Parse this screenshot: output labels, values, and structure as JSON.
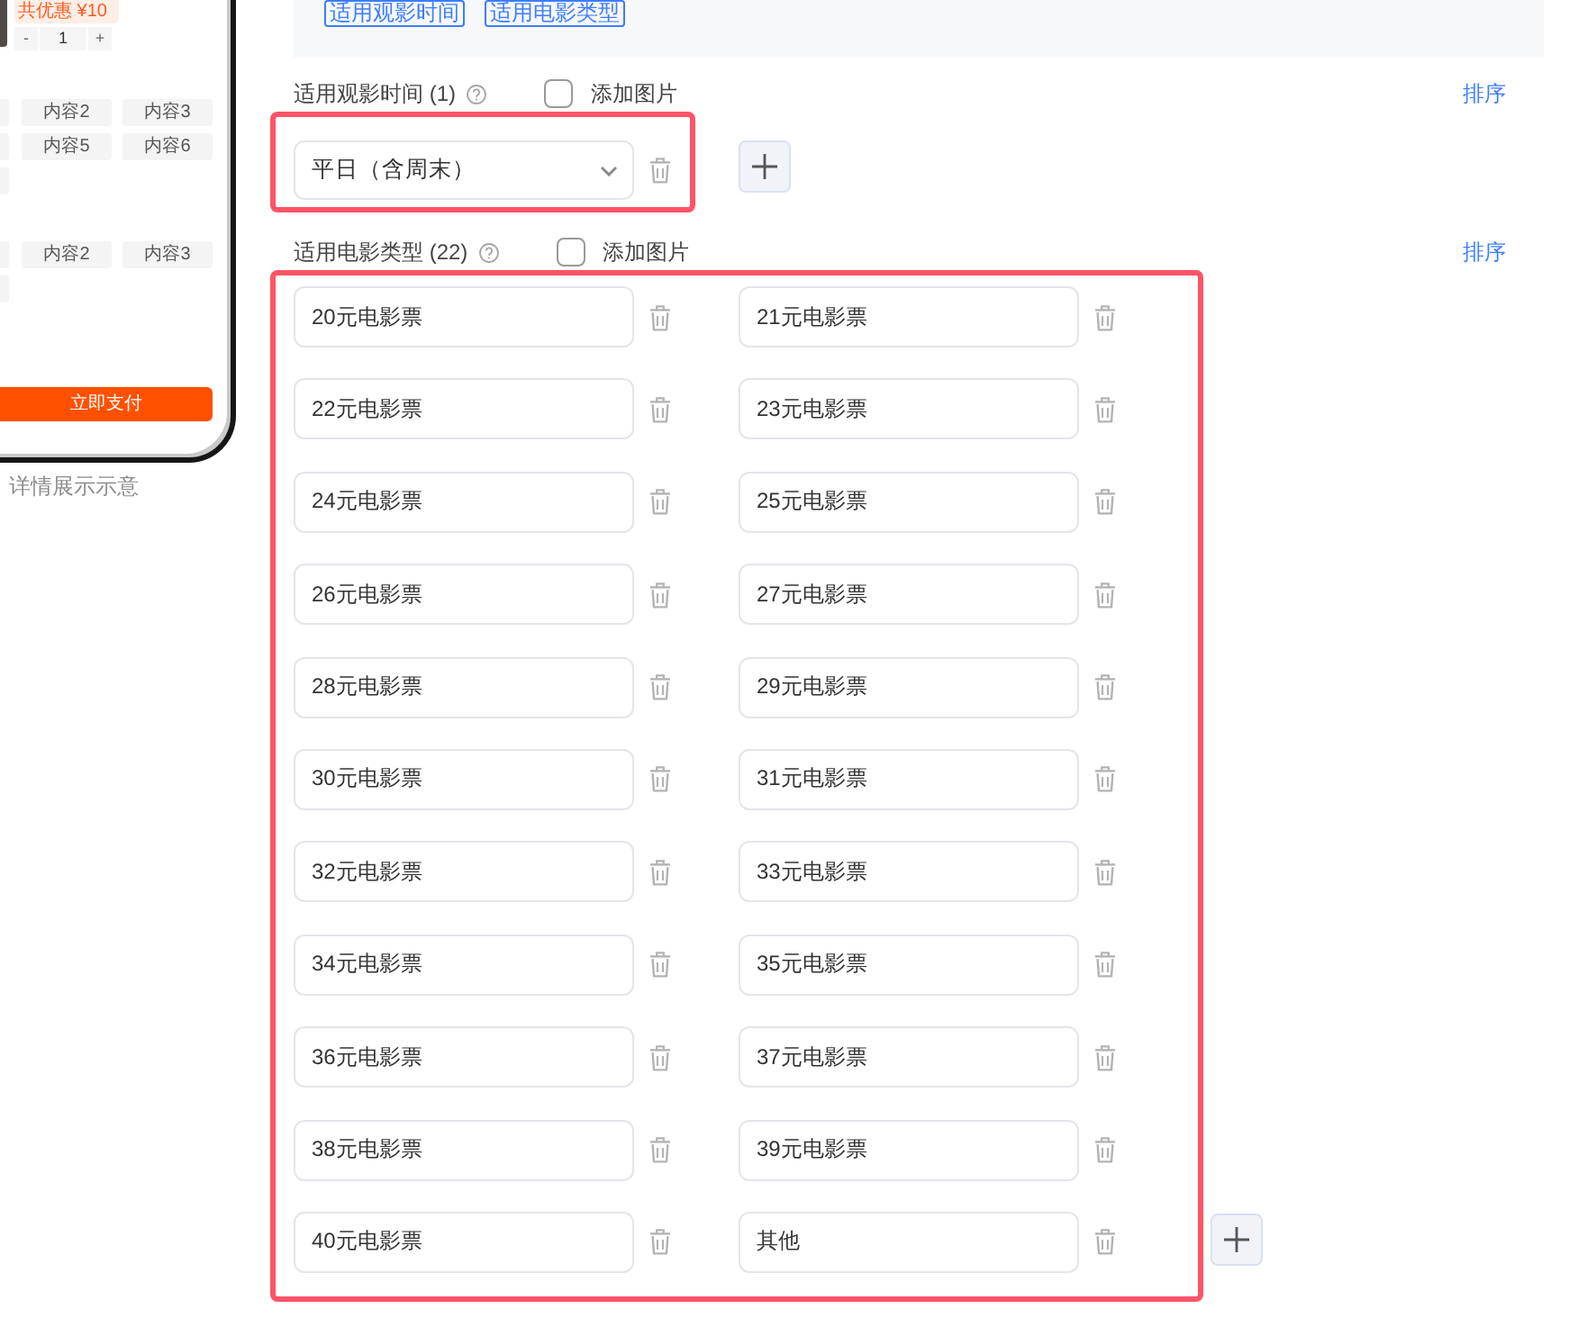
{
  "phone_preview": {
    "discount_badge": "共优惠 ¥10",
    "quantity": {
      "decrease": "-",
      "value": "1",
      "increase": "+"
    },
    "option_groups": [
      {
        "rows": [
          [
            {
              "kind": "clipped"
            },
            {
              "kind": "chip",
              "label": "内容2"
            },
            {
              "kind": "chip",
              "label": "内容3"
            }
          ],
          [
            {
              "kind": "clipped"
            },
            {
              "kind": "chip",
              "label": "内容5"
            },
            {
              "kind": "chip",
              "label": "内容6"
            }
          ],
          [
            {
              "kind": "clipped"
            }
          ]
        ]
      },
      {
        "rows": [
          [
            {
              "kind": "clipped"
            },
            {
              "kind": "chip",
              "label": "内容2"
            },
            {
              "kind": "chip",
              "label": "内容3"
            }
          ],
          [
            {
              "kind": "clipped"
            }
          ]
        ]
      }
    ],
    "pay_button": "立即支付",
    "caption": "详情展示示意"
  },
  "filter_tags": [
    "适用观影时间",
    "适用电影类型"
  ],
  "sections": [
    {
      "title": "适用观影时间 (1)",
      "add_image": {
        "label": "添加图片",
        "checked": false
      },
      "sort_link": "排序",
      "highlighted": true,
      "kind": "select",
      "items": [
        "平日（含周末）"
      ]
    },
    {
      "title": "适用电影类型 (22)",
      "add_image": {
        "label": "添加图片",
        "checked": false
      },
      "sort_link": "排序",
      "highlighted": true,
      "kind": "text",
      "items": [
        "20元电影票",
        "21元电影票",
        "22元电影票",
        "23元电影票",
        "24元电影票",
        "25元电影票",
        "26元电影票",
        "27元电影票",
        "28元电影票",
        "29元电影票",
        "30元电影票",
        "31元电影票",
        "32元电影票",
        "33元电影票",
        "34元电影票",
        "35元电影票",
        "36元电影票",
        "37元电影票",
        "38元电影票",
        "39元电影票",
        "40元电影票",
        "其他"
      ]
    }
  ]
}
